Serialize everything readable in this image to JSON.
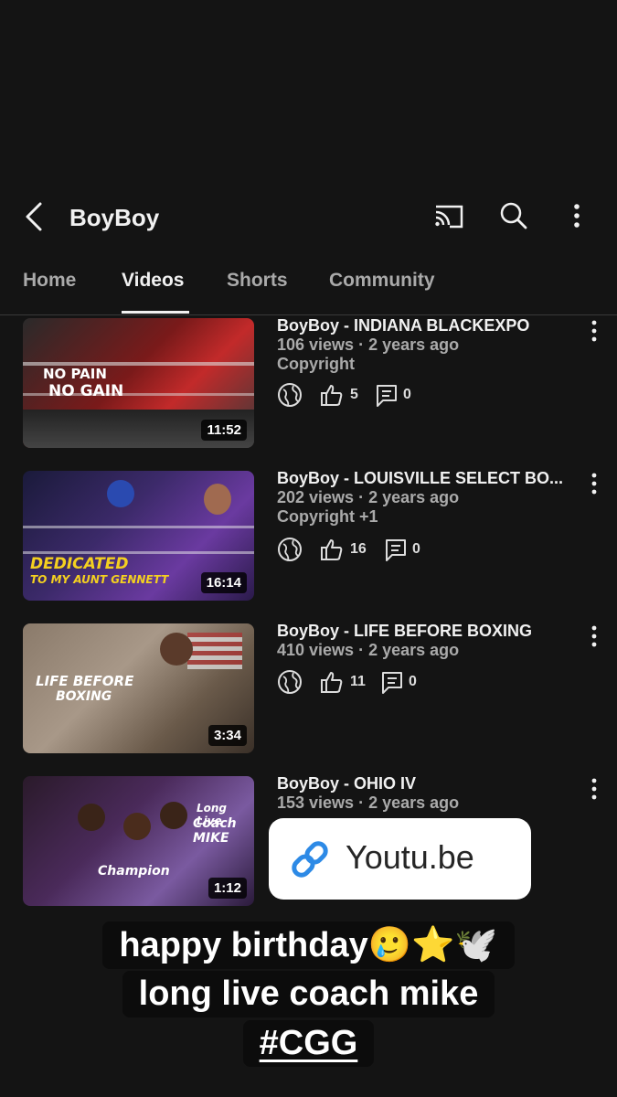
{
  "header": {
    "title": "BoyBoy"
  },
  "tabs": [
    "Home",
    "Videos",
    "Shorts",
    "Community"
  ],
  "videos": [
    {
      "title": "BoyBoy - INDIANA BLACKEXPO",
      "meta": "106 views · 2 years ago",
      "extra": "Copyright",
      "likes": "5",
      "comments": "0",
      "duration": "11:52",
      "thumb_text": [
        "NO PAIN",
        "NO GAIN"
      ]
    },
    {
      "title": "BoyBoy - LOUISVILLE SELECT BO...",
      "meta": "202 views · 2 years ago",
      "extra": "Copyright +1",
      "likes": "16",
      "comments": "0",
      "duration": "16:14",
      "thumb_text": [
        "DEDICATED",
        "TO MY AUNT GENNETT"
      ]
    },
    {
      "title": "BoyBoy - LIFE BEFORE BOXING",
      "meta": "410 views · 2 years ago",
      "extra": "",
      "likes": "11",
      "comments": "0",
      "duration": "3:34",
      "thumb_text": [
        "LIFE BEFORE",
        "BOXING"
      ]
    },
    {
      "title": "BoyBoy - OHIO IV",
      "meta": "153 views · 2 years ago",
      "extra": "",
      "likes": "",
      "comments": "",
      "duration": "1:12",
      "thumb_text": [
        "Long Live",
        "Coach MIKE",
        "Champion"
      ]
    }
  ],
  "link_sticker": {
    "text": "Youtu.be"
  },
  "caption": {
    "line1": "happy birthday🥲⭐🕊️",
    "line2": "long live coach mike",
    "line3": "#CGG"
  },
  "colors": {
    "background": "#141414",
    "text": "#f1f1f1",
    "meta": "#aaaaaa",
    "link_blue": "#2d8ae6"
  },
  "icons": [
    "back-arrow-icon",
    "cast-icon",
    "search-icon",
    "more-vert-icon",
    "globe-icon",
    "thumbs-up-icon",
    "comment-icon",
    "link-icon"
  ]
}
